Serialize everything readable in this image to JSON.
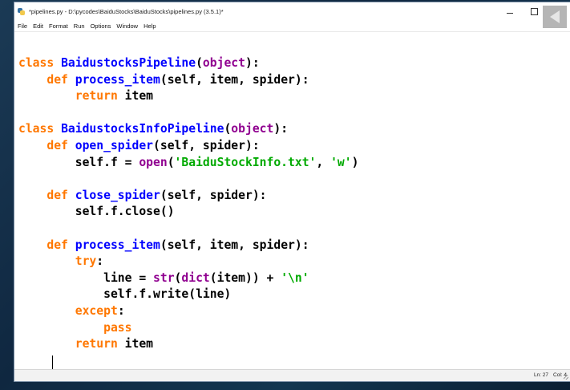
{
  "window": {
    "title": "*pipelines.py - D:\\pycodes\\BaiduStocks\\BaiduStocks\\pipelines.py (3.5.1)*"
  },
  "menu": [
    "File",
    "Edit",
    "Format",
    "Run",
    "Options",
    "Window",
    "Help"
  ],
  "status": {
    "line": "Ln: 27",
    "col": "Col: 4"
  },
  "icons": {
    "app": "python-idle-icon",
    "minimize": "minimize-icon",
    "maximize": "maximize-icon",
    "close": "close-icon",
    "video_overlay": "play-back-icon"
  },
  "syntax_colors": {
    "keyword": "#ff7700",
    "function_name": "#0000ff",
    "builtin": "#900090",
    "string": "#00aa00",
    "default": "#000000"
  },
  "code_lines": [
    [
      {
        "t": "class",
        "c": "kw"
      },
      {
        "t": " "
      },
      {
        "t": "BaidustocksPipeline",
        "c": "fn"
      },
      {
        "t": "("
      },
      {
        "t": "object",
        "c": "bi"
      },
      {
        "t": "):"
      }
    ],
    [
      {
        "t": "    "
      },
      {
        "t": "def",
        "c": "kw"
      },
      {
        "t": " "
      },
      {
        "t": "process_item",
        "c": "fn"
      },
      {
        "t": "(self, item, spider):"
      }
    ],
    [
      {
        "t": "        "
      },
      {
        "t": "return",
        "c": "kw"
      },
      {
        "t": " item"
      }
    ],
    [],
    [
      {
        "t": "class",
        "c": "kw"
      },
      {
        "t": " "
      },
      {
        "t": "BaidustocksInfoPipeline",
        "c": "fn"
      },
      {
        "t": "("
      },
      {
        "t": "object",
        "c": "bi"
      },
      {
        "t": "):"
      }
    ],
    [
      {
        "t": "    "
      },
      {
        "t": "def",
        "c": "kw"
      },
      {
        "t": " "
      },
      {
        "t": "open_spider",
        "c": "fn"
      },
      {
        "t": "(self, spider):"
      }
    ],
    [
      {
        "t": "        self.f = "
      },
      {
        "t": "open",
        "c": "bi"
      },
      {
        "t": "("
      },
      {
        "t": "'BaiduStockInfo.txt'",
        "c": "str"
      },
      {
        "t": ", "
      },
      {
        "t": "'w'",
        "c": "str"
      },
      {
        "t": ")"
      }
    ],
    [],
    [
      {
        "t": "    "
      },
      {
        "t": "def",
        "c": "kw"
      },
      {
        "t": " "
      },
      {
        "t": "close_spider",
        "c": "fn"
      },
      {
        "t": "(self, spider):"
      }
    ],
    [
      {
        "t": "        self.f.close()"
      }
    ],
    [],
    [
      {
        "t": "    "
      },
      {
        "t": "def",
        "c": "kw"
      },
      {
        "t": " "
      },
      {
        "t": "process_item",
        "c": "fn"
      },
      {
        "t": "(self, item, spider):"
      }
    ],
    [
      {
        "t": "        "
      },
      {
        "t": "try",
        "c": "kw"
      },
      {
        "t": ":"
      }
    ],
    [
      {
        "t": "            line = "
      },
      {
        "t": "str",
        "c": "bi"
      },
      {
        "t": "("
      },
      {
        "t": "dict",
        "c": "bi"
      },
      {
        "t": "(item)) + "
      },
      {
        "t": "'\\n'",
        "c": "str"
      }
    ],
    [
      {
        "t": "            self.f.write(line)"
      }
    ],
    [
      {
        "t": "        "
      },
      {
        "t": "except",
        "c": "kw"
      },
      {
        "t": ":"
      }
    ],
    [
      {
        "t": "            "
      },
      {
        "t": "pass",
        "c": "kw"
      }
    ],
    [
      {
        "t": "        "
      },
      {
        "t": "return",
        "c": "kw"
      },
      {
        "t": " item"
      }
    ]
  ]
}
